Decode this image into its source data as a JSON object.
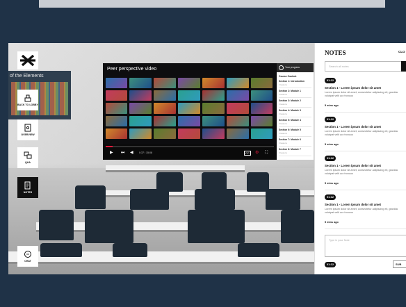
{
  "scene": {
    "wall_chart_label": "of the Elements"
  },
  "sidebar": {
    "logo_icon": "x-logo-icon",
    "items": [
      {
        "label": "BACK TO LOBBY",
        "icon": "lobby-icon"
      },
      {
        "label": "OVERVIEW",
        "icon": "overview-icon"
      },
      {
        "label": "Q&A",
        "icon": "qa-icon"
      },
      {
        "label": "NOTES",
        "icon": "notes-icon",
        "active": true
      },
      {
        "label": "CHAT",
        "icon": "chat-icon"
      }
    ]
  },
  "video": {
    "title": "Peer perspective video",
    "time": "0:37 / 15:08",
    "progress": 0.04,
    "controls": [
      "play-icon",
      "next-icon",
      "volume-icon",
      "cc-icon",
      "settings-icon",
      "fullscreen-icon"
    ]
  },
  "course": {
    "header": "Your progress",
    "heading": "Course Content",
    "items": [
      {
        "title": "Section 1: Introduction",
        "sub": "2 lessons"
      },
      {
        "title": "Section 2: Module 1",
        "sub": "3 lessons"
      },
      {
        "title": "Section 3: Module 2",
        "sub": "3 lessons"
      },
      {
        "title": "Section 4: Module 3",
        "sub": "3 lessons"
      },
      {
        "title": "Section 5: Module 4",
        "sub": "3 lessons"
      },
      {
        "title": "Section 6: Module 5",
        "sub": "3 lessons"
      },
      {
        "title": "Section 7: Module 6",
        "sub": "3 lessons"
      },
      {
        "title": "Section 8: Module 7",
        "sub": "3 lessons"
      }
    ]
  },
  "notes": {
    "title": "NOTES",
    "close_label": "CLO",
    "search_placeholder": "Search all notes",
    "items": [
      {
        "time": "01:12",
        "title": "Section 1 - Lorem ipsum dolor sit amet",
        "body": "Lorem ipsum dolor sit amet, consectetur adipiscing eli, gravida volutpat velit ac rhoncus",
        "ago": "5 mins ago"
      },
      {
        "time": "01:12",
        "title": "Section 1 - Lorem ipsum dolor sit amet",
        "body": "Lorem ipsum dolor sit amet, consectetur adipiscing eli, gravida volutpat velit ac rhoncus",
        "ago": "5 mins ago"
      },
      {
        "time": "01:12",
        "title": "Section 1 - Lorem ipsum dolor sit amet",
        "body": "Lorem ipsum dolor sit amet, consectetur adipiscing eli, gravida volutpat velit ac rhoncus",
        "ago": "5 mins ago"
      },
      {
        "time": "01:12",
        "title": "Section 1 - Lorem ipsum dolor sit amet",
        "body": "Lorem ipsum dolor sit amet, consectetur adipiscing eli, gravida volutpat velit ac rhoncus",
        "ago": "5 mins ago"
      }
    ],
    "compose_placeholder": "Type in your Note",
    "compose_time": "01:12",
    "submit_label": "SUB"
  },
  "colors": {
    "frame": "#1f3247",
    "accent": "#e0183a",
    "active_nav": "#111111"
  }
}
